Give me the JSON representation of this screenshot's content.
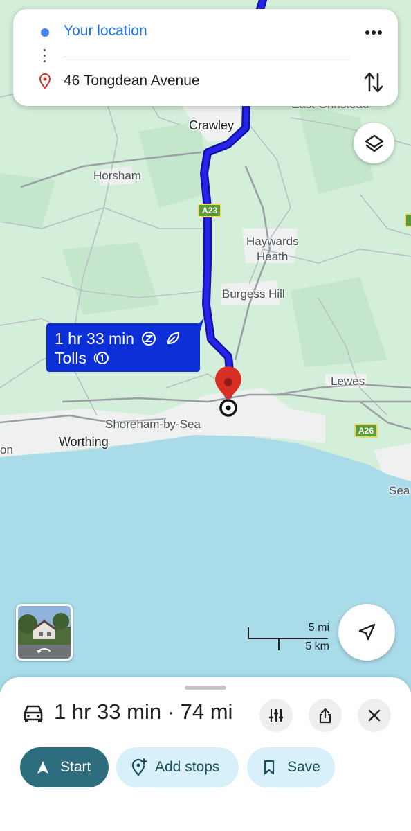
{
  "search": {
    "origin": "Your location",
    "destination": "46 Tongdean Avenue"
  },
  "map": {
    "places": {
      "crawley": "Crawley",
      "horsham": "Horsham",
      "haywards_heath_1": "Haywards",
      "haywards_heath_2": "Heath",
      "burgess_hill": "Burgess Hill",
      "lewes": "Lewes",
      "shoreham": "Shoreham-by-Sea",
      "worthing": "Worthing",
      "east_grinstead": "East Grinstead",
      "seaford_partial": "Sea",
      "left_partial": "on"
    },
    "roads": {
      "a23": "A23",
      "a26": "A26"
    },
    "route_tag": {
      "duration": "1 hr 33 min",
      "tolls": "Tolls"
    },
    "scale": {
      "miles": "5 mi",
      "km": "5 km"
    },
    "colors": {
      "land": "#d3eed9",
      "urban": "#eef1ef",
      "water": "#a9dbe9",
      "route": "#1b1bdc",
      "route_outline": "#1212a8",
      "pin": "#d93025"
    }
  },
  "route_summary": {
    "duration": "1 hr 33 min",
    "separator": " · ",
    "distance": "74 mi",
    "icon": "car-icon"
  },
  "actions": {
    "start": "Start",
    "add_stops": "Add stops",
    "save": "Save"
  },
  "icons": [
    "more-vert-icon",
    "swap-icon",
    "layers-icon",
    "navigation-icon",
    "options-icon",
    "share-icon",
    "close-icon",
    "bookmark-icon",
    "add-location-icon"
  ]
}
